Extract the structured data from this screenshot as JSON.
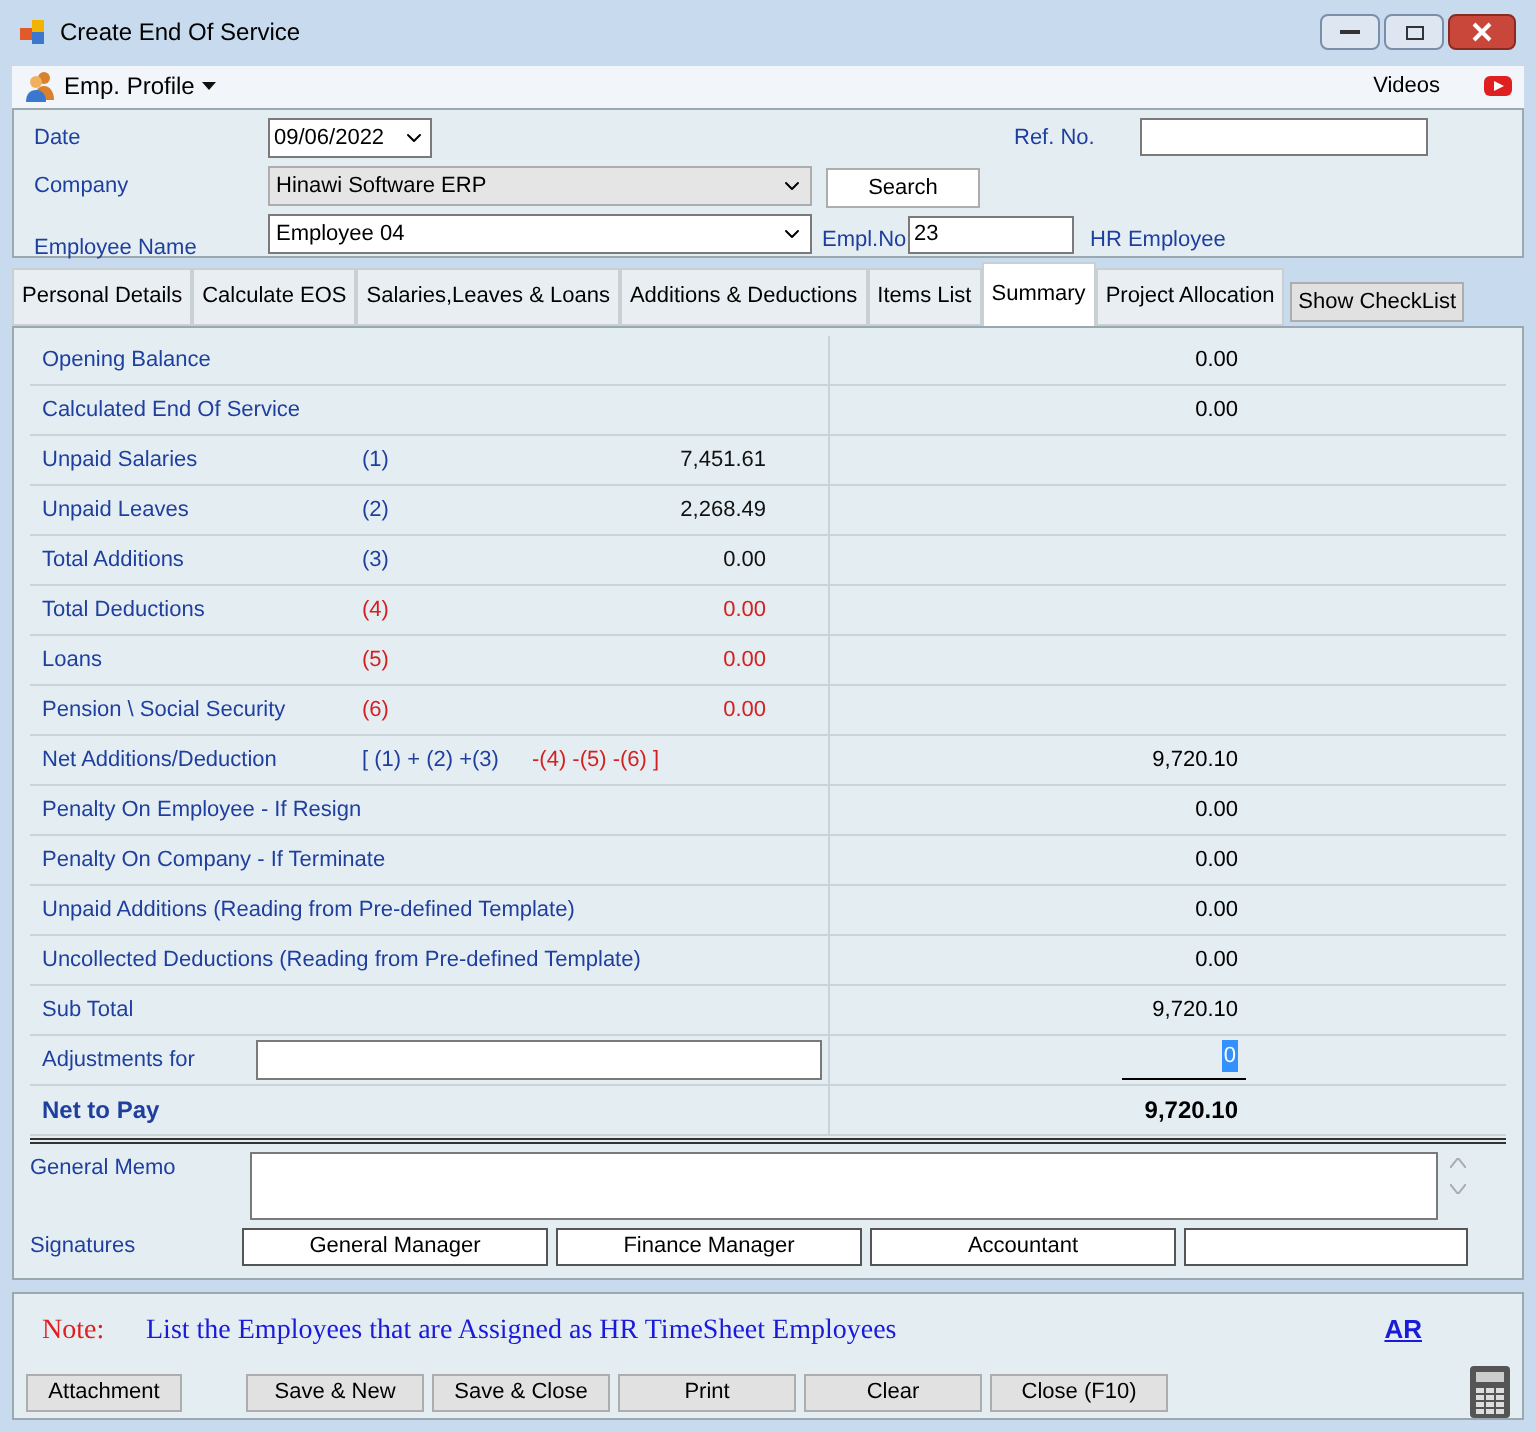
{
  "window": {
    "title": "Create End Of Service"
  },
  "toolbar": {
    "profile": "Emp. Profile",
    "videos": "Videos"
  },
  "header": {
    "date_label": "Date",
    "date": "09/06/2022",
    "ref_label": "Ref. No.",
    "company_label": "Company",
    "company": "Hinawi Software ERP",
    "search": "Search",
    "employee_label": "Employee Name",
    "employee": "Employee 04",
    "empl_no_label": "Empl.No",
    "empl_no": "23",
    "hr_link": "HR Employee"
  },
  "tabs": [
    {
      "label": "Personal Details",
      "selected": false
    },
    {
      "label": "Calculate EOS",
      "selected": false
    },
    {
      "label": "Salaries,Leaves & Loans",
      "selected": false
    },
    {
      "label": "Additions & Deductions",
      "selected": false
    },
    {
      "label": "Items List",
      "selected": false
    },
    {
      "label": "Summary",
      "selected": true
    },
    {
      "label": "Project Allocation",
      "selected": false
    }
  ],
  "checklist_button": "Show CheckList",
  "summary_rows": [
    {
      "kind": "line",
      "label": "Opening Balance",
      "total": "0.00"
    },
    {
      "kind": "line",
      "label": "Calculated End Of Service",
      "total": "0.00"
    },
    {
      "kind": "part",
      "label": "Unpaid Salaries",
      "ref": "(1)",
      "amount": "7,451.61",
      "deduction": false
    },
    {
      "kind": "part",
      "label": "Unpaid Leaves",
      "ref": "(2)",
      "amount": "2,268.49",
      "deduction": false
    },
    {
      "kind": "part",
      "label": "Total Additions",
      "ref": "(3)",
      "amount": "0.00",
      "deduction": false
    },
    {
      "kind": "part",
      "label": "Total Deductions",
      "ref": "(4)",
      "amount": "0.00",
      "deduction": true
    },
    {
      "kind": "part",
      "label": "Loans",
      "ref": "(5)",
      "amount": "0.00",
      "deduction": true
    },
    {
      "kind": "part",
      "label": "Pension \\ Social Security",
      "ref": "(6)",
      "amount": "0.00",
      "deduction": true
    },
    {
      "kind": "formula",
      "label": "Net Additions/Deduction",
      "plus": "[ (1) + (2) +(3)",
      "minus": "-(4) -(5) -(6) ]",
      "total": "9,720.10"
    },
    {
      "kind": "line",
      "label": "Penalty On Employee - If Resign",
      "total": "0.00"
    },
    {
      "kind": "line",
      "label": "Penalty On Company - If Terminate",
      "total": "0.00"
    },
    {
      "kind": "line",
      "label": "Unpaid Additions (Reading from Pre-defined Template)",
      "total": "0.00"
    },
    {
      "kind": "line",
      "label": "Uncollected Deductions (Reading from Pre-defined Template)",
      "total": "0.00"
    },
    {
      "kind": "line",
      "label": "Sub Total",
      "total": "9,720.10"
    },
    {
      "kind": "adjust",
      "label": "Adjustments for",
      "total": "0"
    },
    {
      "kind": "net",
      "label": "Net to Pay",
      "total": "9,720.10"
    }
  ],
  "memo_label": "General Memo",
  "signatures_label": "Signatures",
  "signatures": [
    "General Manager",
    "Finance Manager",
    "Accountant"
  ],
  "note": {
    "label": "Note:",
    "text": "List the Employees that are Assigned as HR  TimeSheet Employees",
    "link": "AR"
  },
  "attachment": "Attachment",
  "buttons": [
    "Save & New",
    "Save & Close",
    "Print",
    "Clear",
    "Close (F10)"
  ]
}
